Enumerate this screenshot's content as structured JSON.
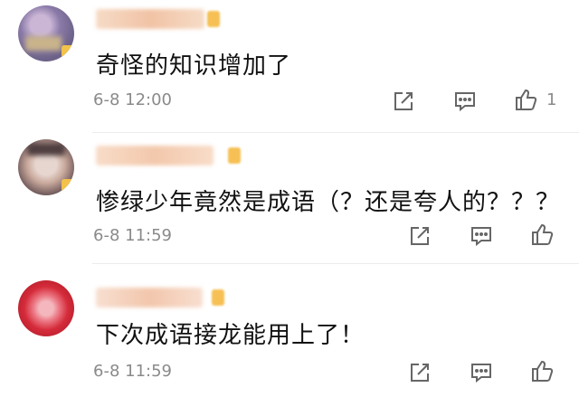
{
  "comments": [
    {
      "text": "奇怪的知识增加了",
      "time": "6-8 12:00",
      "likes": "1",
      "avatar_colors": [
        "#8a7aa8",
        "#c9b48a",
        "#6c6288"
      ]
    },
    {
      "text": "惨绿少年竟然是成语（？还是夸人的？？？",
      "time": "6-8 11:59",
      "likes": "",
      "avatar_colors": [
        "#c9a99c",
        "#6a5456",
        "#e7d6cf"
      ]
    },
    {
      "text": "下次成语接龙能用上了！",
      "time": "6-8 11:59",
      "likes": "",
      "avatar_colors": [
        "#d52b3a",
        "#ec7a86",
        "#b8202e"
      ]
    }
  ],
  "icons": {
    "share": "share-icon",
    "comment": "comment-icon",
    "like": "thumbs-up-icon"
  },
  "colors": {
    "text": "#111111",
    "meta": "#8a8a8a",
    "badge": "#f6c054"
  }
}
